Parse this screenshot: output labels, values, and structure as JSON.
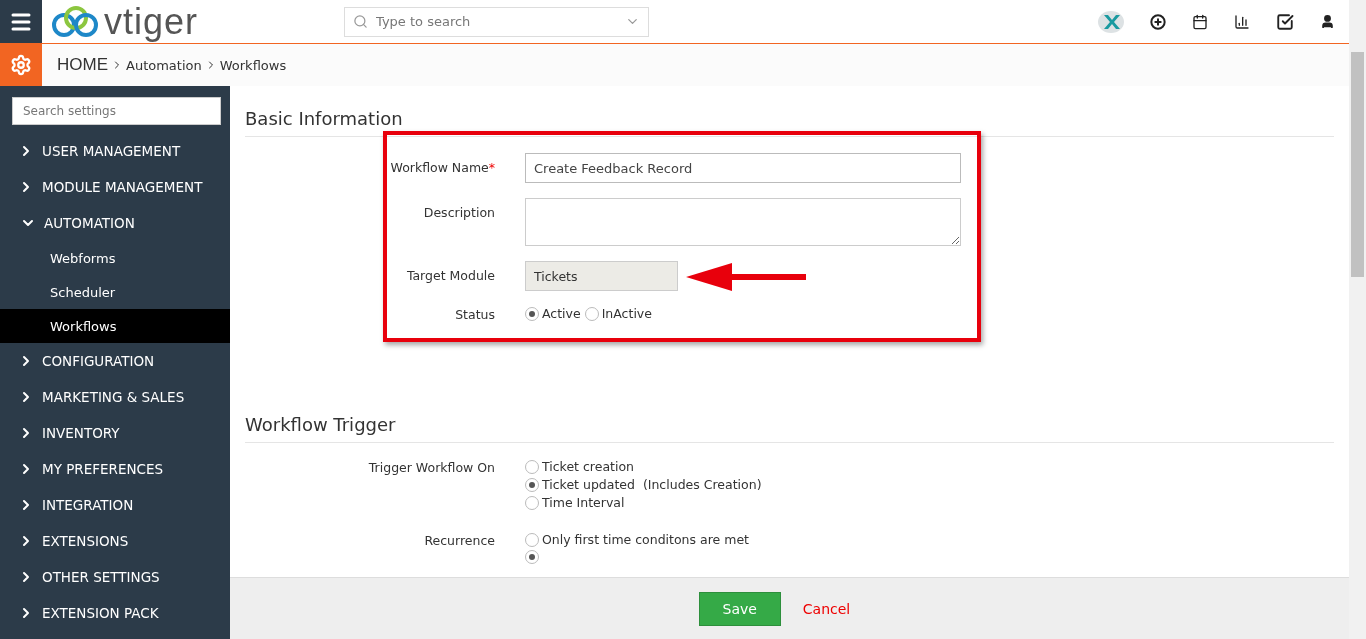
{
  "topbar": {
    "logo": "vtiger",
    "search": {
      "placeholder": "Type to search"
    }
  },
  "breadcrumb": [
    "HOME",
    "Automation",
    "Workflows"
  ],
  "sidebar": {
    "search": {
      "placeholder": "Search settings"
    },
    "items": [
      {
        "label": "USER MANAGEMENT",
        "expanded": false
      },
      {
        "label": "MODULE MANAGEMENT",
        "expanded": false
      },
      {
        "label": "AUTOMATION",
        "expanded": true,
        "children": [
          {
            "label": "Webforms",
            "selected": false
          },
          {
            "label": "Scheduler",
            "selected": false
          },
          {
            "label": "Workflows",
            "selected": true
          }
        ]
      },
      {
        "label": "CONFIGURATION",
        "expanded": false
      },
      {
        "label": "MARKETING & SALES",
        "expanded": false
      },
      {
        "label": "INVENTORY",
        "expanded": false
      },
      {
        "label": "MY PREFERENCES",
        "expanded": false
      },
      {
        "label": "INTEGRATION",
        "expanded": false
      },
      {
        "label": "EXTENSIONS",
        "expanded": false
      },
      {
        "label": "OTHER SETTINGS",
        "expanded": false
      },
      {
        "label": "EXTENSION PACK",
        "expanded": false
      }
    ]
  },
  "sections": [
    {
      "title": "Basic Information",
      "annotated": true,
      "fields": [
        {
          "kind": "text",
          "label": "Workflow Name",
          "required_mark": "*",
          "value": "Create Feedback Record"
        },
        {
          "kind": "textarea",
          "label": "Description"
        },
        {
          "kind": "readonly",
          "label": "Target Module",
          "value": "Tickets"
        },
        {
          "kind": "radio",
          "label": "Status",
          "inline": true,
          "options": [
            {
              "label": "Active",
              "selected": true
            },
            {
              "label": "InActive",
              "selected": false
            }
          ]
        }
      ]
    },
    {
      "title": "Workflow Trigger",
      "annotated": false,
      "fields": [
        {
          "kind": "radio",
          "label": "Trigger Workflow On",
          "inline": false,
          "options": [
            {
              "label": "Ticket creation",
              "selected": false
            },
            {
              "label": "Ticket updated  (Includes Creation)",
              "selected": true
            },
            {
              "label": "Time Interval",
              "selected": false
            }
          ]
        },
        {
          "kind": "radio",
          "label": "Recurrence",
          "inline": false,
          "options": [
            {
              "label": "Only first time conditons are met",
              "selected": false
            },
            {
              "selected": true
            }
          ]
        }
      ]
    }
  ],
  "footer": {
    "save": "Save",
    "cancel": "Cancel"
  }
}
